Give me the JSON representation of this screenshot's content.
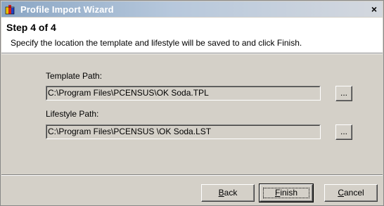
{
  "window": {
    "title": "Profile Import Wizard",
    "close_glyph": "×",
    "icon": "wizard-app-icon"
  },
  "header": {
    "step": "Step 4 of 4",
    "instructions": "Specify the location the template and lifestyle will be saved to and click Finish."
  },
  "template": {
    "label": "Template Path:",
    "value": "C:\\Program Files\\PCENSUS\\OK Soda.TPL",
    "browse_label": "..."
  },
  "lifestyle": {
    "label": "Lifestyle Path:",
    "value": "C:\\Program Files\\PCENSUS \\OK Soda.LST",
    "browse_label": "..."
  },
  "buttons": {
    "back": {
      "mnemonic": "B",
      "rest": "ack"
    },
    "finish": {
      "mnemonic": "F",
      "rest": "inish"
    },
    "cancel": {
      "mnemonic": "C",
      "rest": "ancel"
    }
  }
}
